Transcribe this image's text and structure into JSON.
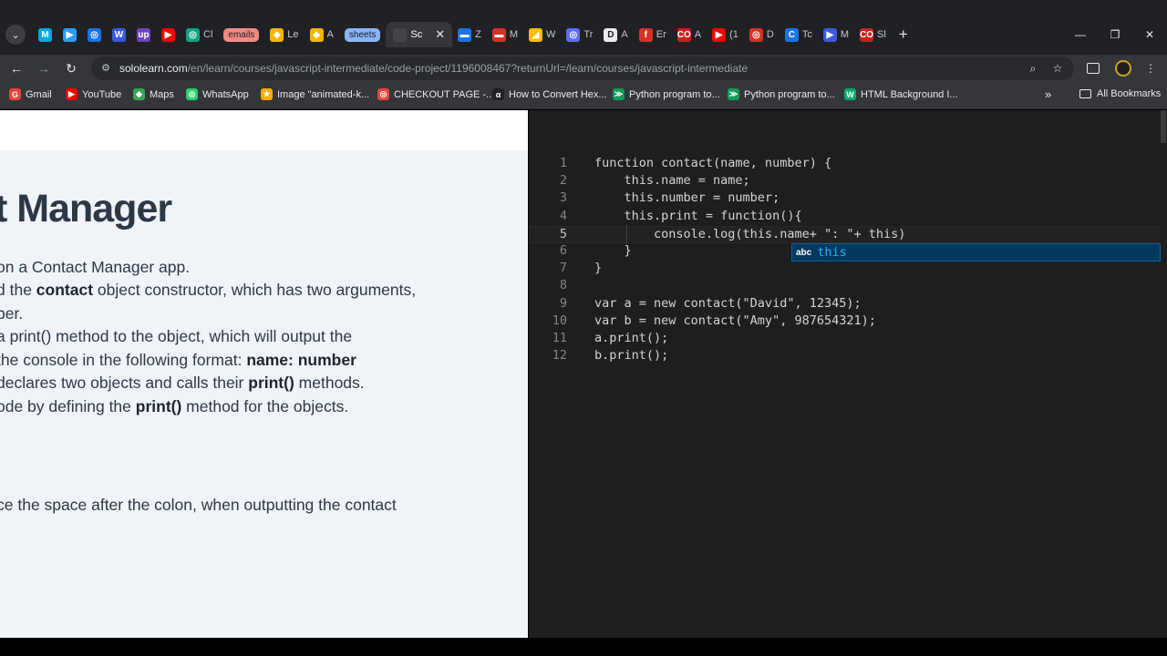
{
  "browser": {
    "tabs": [
      {
        "title": "",
        "fav": "M",
        "color": "#00a7e1",
        "style": "letter"
      },
      {
        "title": "",
        "fav": "▶",
        "color": "#2a9df4",
        "style": "letter"
      },
      {
        "title": "",
        "fav": "◎",
        "color": "#1a73e8",
        "style": "letter"
      },
      {
        "title": "",
        "fav": "W",
        "color": "#3b5bdb",
        "style": "letter"
      },
      {
        "title": "",
        "fav": "up",
        "color": "#6f42c1",
        "style": "letter"
      },
      {
        "title": "",
        "fav": "▶",
        "color": "#ff0000",
        "style": "letter"
      },
      {
        "title": "Cl",
        "fav": "◎",
        "color": "#10a37f",
        "style": "letter"
      },
      {
        "title": "emails",
        "fav": "",
        "color": "#f28b82",
        "style": "pill"
      },
      {
        "title": "Le",
        "fav": "◆",
        "color": "#f4b400",
        "style": "letter"
      },
      {
        "title": "A",
        "fav": "◆",
        "color": "#f4b400",
        "style": "letter"
      },
      {
        "title": "sheets",
        "fav": "",
        "color": "#8ab4f8",
        "style": "pill"
      },
      {
        "title": "Sc",
        "fav": "",
        "color": "#35363a",
        "style": "active"
      },
      {
        "title": "Z",
        "fav": "▬",
        "color": "#1a73e8",
        "style": "letter"
      },
      {
        "title": "M",
        "fav": "▬",
        "color": "#d93025",
        "style": "letter"
      },
      {
        "title": "W",
        "fav": "◢",
        "color": "#fbbc04",
        "style": "letter"
      },
      {
        "title": "Tr",
        "fav": "◎",
        "color": "#5f6bff",
        "style": "letter"
      },
      {
        "title": "A",
        "fav": "D",
        "color": "#e8eaed",
        "style": "letter"
      },
      {
        "title": "Er",
        "fav": "f",
        "color": "#d93025",
        "style": "letter"
      },
      {
        "title": "A",
        "fav": "CO",
        "color": "#c5221f",
        "style": "letter"
      },
      {
        "title": "(1",
        "fav": "▶",
        "color": "#ff0000",
        "style": "letter"
      },
      {
        "title": "D",
        "fav": "◎",
        "color": "#d93025",
        "style": "letter"
      },
      {
        "title": "Tc",
        "fav": "C",
        "color": "#1a73e8",
        "style": "letter"
      },
      {
        "title": "M",
        "fav": "▶",
        "color": "#3b5bdb",
        "style": "letter"
      },
      {
        "title": "Sl",
        "fav": "CO",
        "color": "#c5221f",
        "style": "letter"
      }
    ],
    "close_tab_glyph": "✕",
    "new_tab_glyph": "+",
    "window_controls": {
      "minimize": "—",
      "restore": "❐",
      "close": "✕"
    },
    "nav": {
      "back": "←",
      "forward": "→",
      "reload": "↻"
    },
    "url_host": "sololearn.com",
    "url_path": "/en/learn/courses/javascript-intermediate/code-project/1196008467?returnUrl=/learn/courses/javascript-intermediate",
    "omnibox_icons": {
      "site_info": "⚙",
      "zoom": "⌕",
      "bookmark": "☆"
    },
    "bookmarks": [
      {
        "label": "Gmail",
        "icon": "G",
        "color": "#ea4335"
      },
      {
        "label": "YouTube",
        "icon": "▶",
        "color": "#ff0000"
      },
      {
        "label": "Maps",
        "icon": "◆",
        "color": "#34a853"
      },
      {
        "label": "WhatsApp",
        "icon": "◎",
        "color": "#25d366"
      },
      {
        "label": "Image \"animated-k...",
        "icon": "★",
        "color": "#f9ab00"
      },
      {
        "label": "CHECKOUT PAGE -...",
        "icon": "◎",
        "color": "#e8453c"
      },
      {
        "label": "How to Convert Hex...",
        "icon": "α",
        "color": "#202124"
      },
      {
        "label": "Python program to...",
        "icon": "≫",
        "color": "#0f9d58"
      },
      {
        "label": "Python program to...",
        "icon": "≫",
        "color": "#0f9d58"
      },
      {
        "label": "HTML Background I...",
        "icon": "W",
        "color": "#04aa6d"
      }
    ],
    "bookmarks_more": "»",
    "all_bookmarks": "All Bookmarks"
  },
  "lesson": {
    "title": "t Manager",
    "lines": [
      {
        "parts": [
          {
            "t": " on a Contact Manager app.",
            "b": false
          }
        ]
      },
      {
        "parts": [
          {
            "t": "d the ",
            "b": false
          },
          {
            "t": "contact",
            "b": true
          },
          {
            "t": " object constructor, which has two arguments,",
            "b": false
          }
        ]
      },
      {
        "parts": [
          {
            "t": "ber.",
            "b": false
          }
        ]
      },
      {
        "parts": [
          {
            "t": " a print() method to the object, which will output the",
            "b": false
          }
        ]
      },
      {
        "parts": [
          {
            "t": " the console in the following format: ",
            "b": false
          },
          {
            "t": "name: number",
            "b": true
          }
        ]
      },
      {
        "parts": [
          {
            "t": "declares two objects and calls their ",
            "b": false
          },
          {
            "t": "print()",
            "b": true
          },
          {
            "t": " methods.",
            "b": false
          }
        ]
      },
      {
        "parts": [
          {
            "t": "ode by defining the ",
            "b": false
          },
          {
            "t": "print()",
            "b": true
          },
          {
            "t": " method for the objects.",
            "b": false
          }
        ]
      },
      {
        "parts": [
          {
            "t": "ce the space after the colon, when outputting the contact",
            "b": false
          }
        ]
      },
      {
        "parts": [
          {
            "t": ".",
            "b": false
          }
        ]
      }
    ]
  },
  "editor": {
    "lines": [
      {
        "n": "1",
        "code": "function contact(name, number) {"
      },
      {
        "n": "2",
        "code": "    this.name = name;"
      },
      {
        "n": "3",
        "code": "    this.number = number;"
      },
      {
        "n": "4",
        "code": "    this.print = function(){"
      },
      {
        "n": "5",
        "code": "        console.log(this.name+ \": \"+ this)"
      },
      {
        "n": "6",
        "code": "    }"
      },
      {
        "n": "7",
        "code": "}"
      },
      {
        "n": "8",
        "code": ""
      },
      {
        "n": "9",
        "code": "var a = new contact(\"David\", 12345);"
      },
      {
        "n": "10",
        "code": "var b = new contact(\"Amy\", 987654321);"
      },
      {
        "n": "11",
        "code": "a.print();"
      },
      {
        "n": "12",
        "code": "b.print();"
      }
    ],
    "current_line": "5",
    "suggestion": {
      "kind": "abc",
      "word": "this"
    }
  }
}
